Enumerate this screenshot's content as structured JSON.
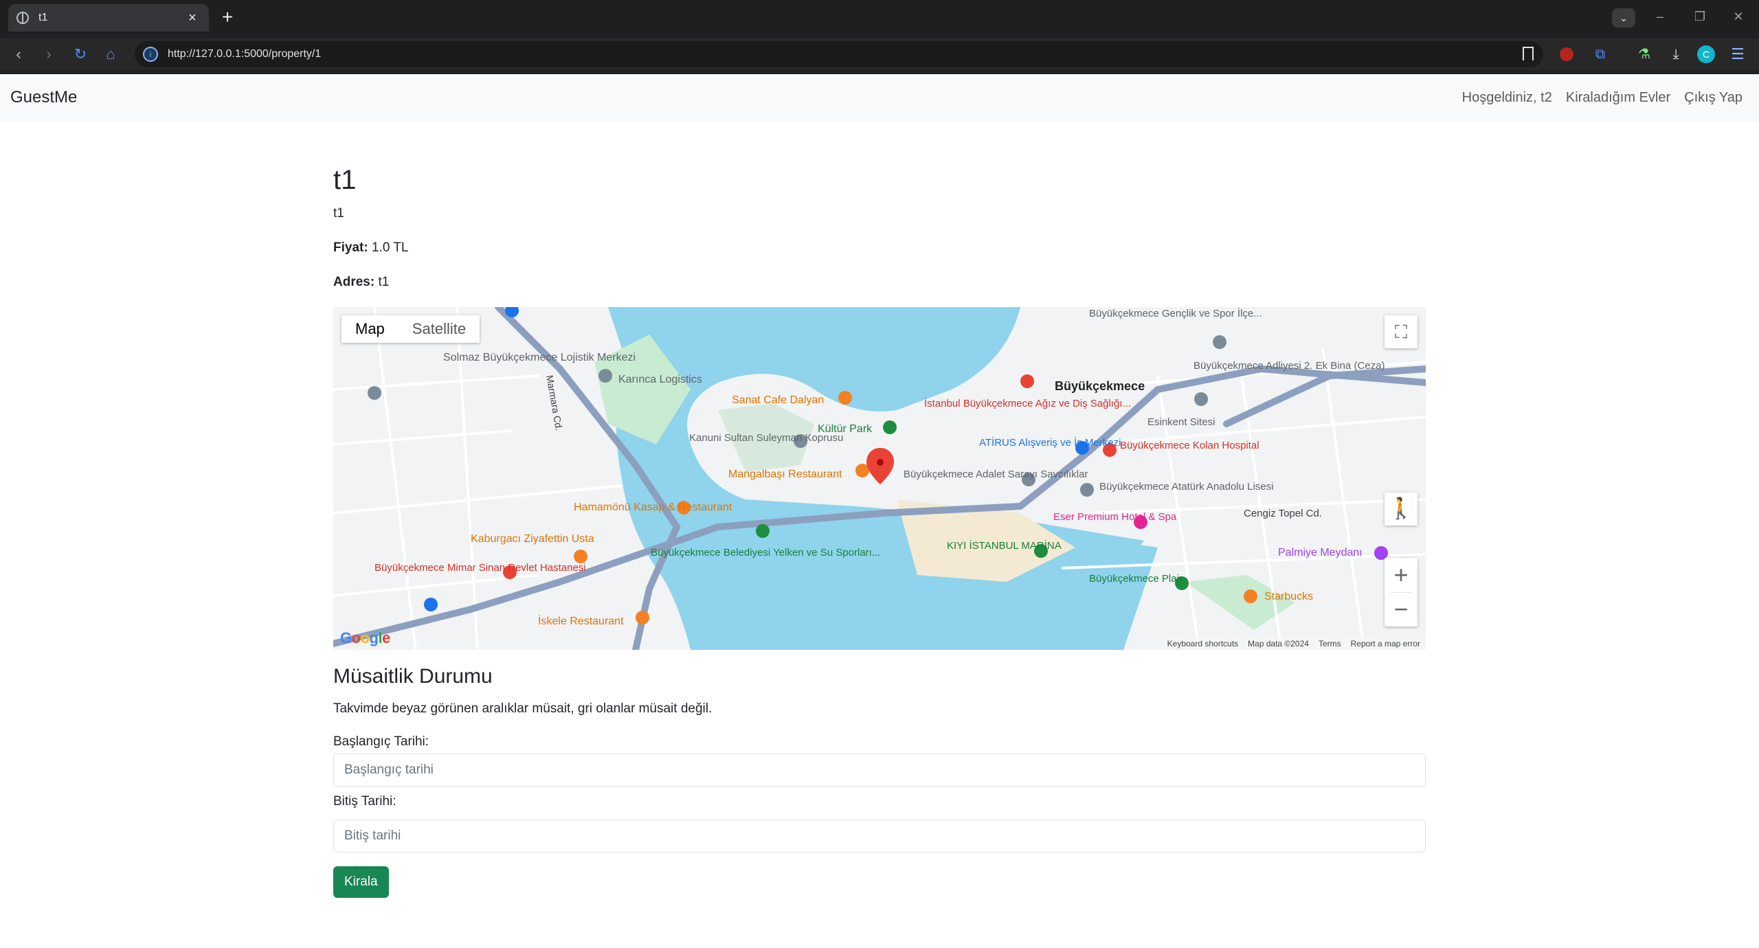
{
  "browser": {
    "tab_title": "t1",
    "url": "http://127.0.0.1:5000/property/1",
    "profile_initial": "C"
  },
  "navbar": {
    "brand": "GuestMe",
    "links": [
      "Hoşgeldiniz, t2",
      "Kiraladığım Evler",
      "Çıkış Yap"
    ]
  },
  "property": {
    "title": "t1",
    "description": "t1",
    "price_label": "Fiyat:",
    "price_value": "1.0 TL",
    "address_label": "Adres:",
    "address_value": "t1"
  },
  "map": {
    "type_options": [
      "Map",
      "Satellite"
    ],
    "selected_type": "Map",
    "attribution": [
      "Keyboard shortcuts",
      "Map data ©2024",
      "Terms",
      "Report a map error"
    ],
    "logo": "Google",
    "labels": [
      "Solmaz Büyükçekmece Lojistik Merkezi",
      "Karınca Logistics",
      "Sanat Cafe Dalyan",
      "Kültür Park",
      "Kanuni Sultan Suleyman Koprusu",
      "Mangalbaşı Restaurant",
      "Hamamönü Kasap & Restaurant",
      "Kaburgacı Ziyafettin Usta",
      "Büyükçekmece Mimar Sinan Devlet Hastanesi",
      "İskele Restaurant",
      "Büyükçekmece Belediyesi Yelken ve Su Sporları...",
      "İstanbul Büyükçekmece Ağız ve Diş Sağlığı...",
      "Büyükçekmece",
      "ATİRUS Alışveriş ve İş Merkezi",
      "Büyükçekmece Kolan Hospital",
      "Büyükçekmece Adalet Sarayı Savcılıklar",
      "Büyükçekmece Atatürk Anadolu Lisesi",
      "Eser Premium Hotel & Spa",
      "KIYI İSTANBUL MARİNA",
      "Büyükçekmece Plajı",
      "Starbucks",
      "Palmiye Meydanı",
      "Esinkent Sitesi",
      "Büyükçekmece Adliyesi 2. Ek Bina (Ceza)",
      "Büyükçekmece Gençlik ve Spor İlçe...",
      "Cengiz Topel Cd.",
      "Marmara Cd."
    ],
    "colors": {
      "water": "#8fd3ec",
      "land": "#f2f3f4",
      "park": "#c9ebd2",
      "highway": "#8c9fbf",
      "pin": "#ea4335"
    }
  },
  "availability": {
    "title": "Müsaitlik Durumu",
    "text": "Takvimde beyaz görünen aralıklar müsait, gri olanlar müsait değil.",
    "start_label": "Başlangıç Tarihi:",
    "start_placeholder": "Başlangıç tarihi",
    "end_label": "Bitiş Tarihi:",
    "end_placeholder": "Bitiş tarihi",
    "submit": "Kirala"
  }
}
